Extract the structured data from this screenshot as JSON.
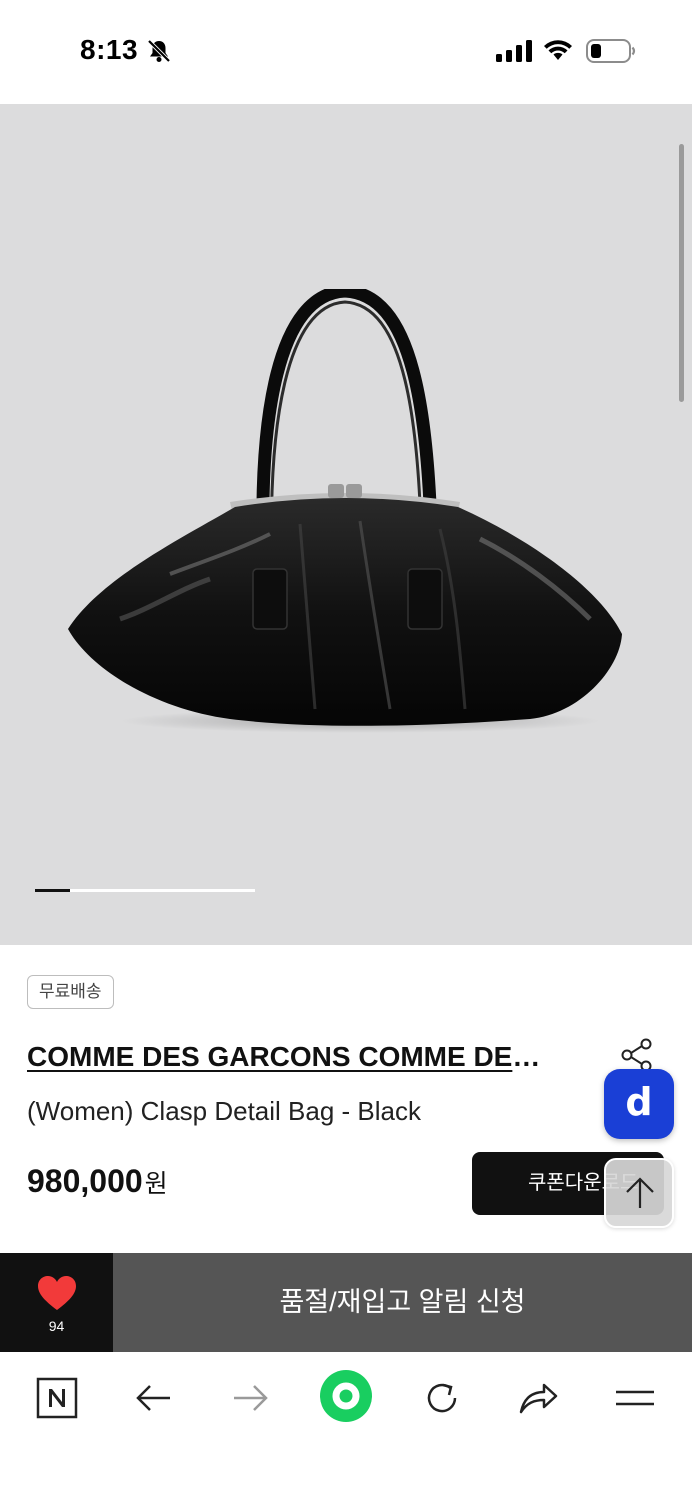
{
  "status_bar": {
    "time": "8:13",
    "icons": [
      "bell-off-icon",
      "cellular-signal-icon",
      "wifi-icon",
      "battery-icon"
    ]
  },
  "gallery": {
    "current_index": 1,
    "progress_fraction": 0.16,
    "image_icon": "black-clasp-bag"
  },
  "product": {
    "badge": "무료배송",
    "brand": "COMME DES GARCONS COMME DES GARCONS",
    "name": "(Women) Clasp Detail Bag - Black",
    "price": "980,000",
    "currency_unit": "원",
    "coupon_label": "쿠폰다운로드"
  },
  "floating": {
    "badge_letter": "d",
    "badge_color": "#1a3fd6"
  },
  "action_bar": {
    "like_count": "94",
    "heart_color": "#f23a3a",
    "restock_label": "품절/재입고 알림 신청"
  },
  "browser_toolbar": {
    "items": [
      "naver-home-icon",
      "back-arrow-icon",
      "forward-arrow-icon",
      "green-dot-icon",
      "reload-icon",
      "share-icon",
      "menu-icon"
    ],
    "accent": "#19ce60"
  }
}
